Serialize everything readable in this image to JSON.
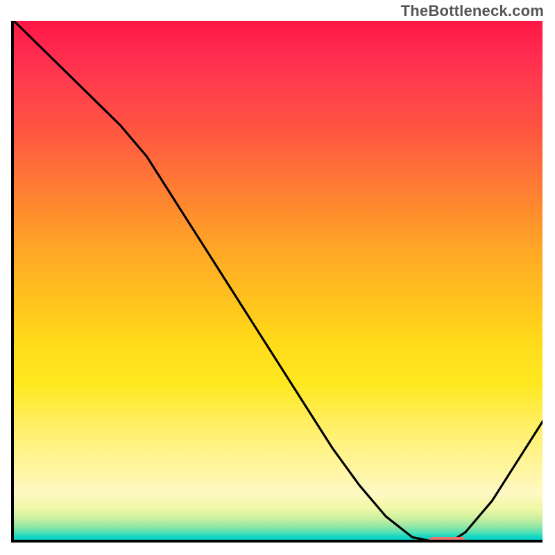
{
  "watermark": "TheBottleneck.com",
  "chart_data": {
    "type": "line",
    "title": "",
    "xlabel": "",
    "ylabel": "",
    "xlim": [
      0,
      100
    ],
    "ylim": [
      0,
      100
    ],
    "x": [
      0,
      5,
      10,
      15,
      20,
      25,
      30,
      35,
      40,
      45,
      50,
      55,
      60,
      65,
      70,
      75,
      80,
      82,
      85,
      90,
      95,
      100
    ],
    "values": [
      100,
      95,
      90,
      85,
      80,
      74,
      66,
      58,
      50,
      42,
      34,
      26,
      18,
      11,
      5,
      1,
      0,
      0,
      2,
      8,
      16,
      24
    ],
    "flat_min_range_x": [
      78,
      85
    ],
    "gradient_note": "Background color encodes y-value, green at bottom (0) through yellow/orange to red at top (100)."
  },
  "marker": {
    "color": "#e8766e"
  }
}
